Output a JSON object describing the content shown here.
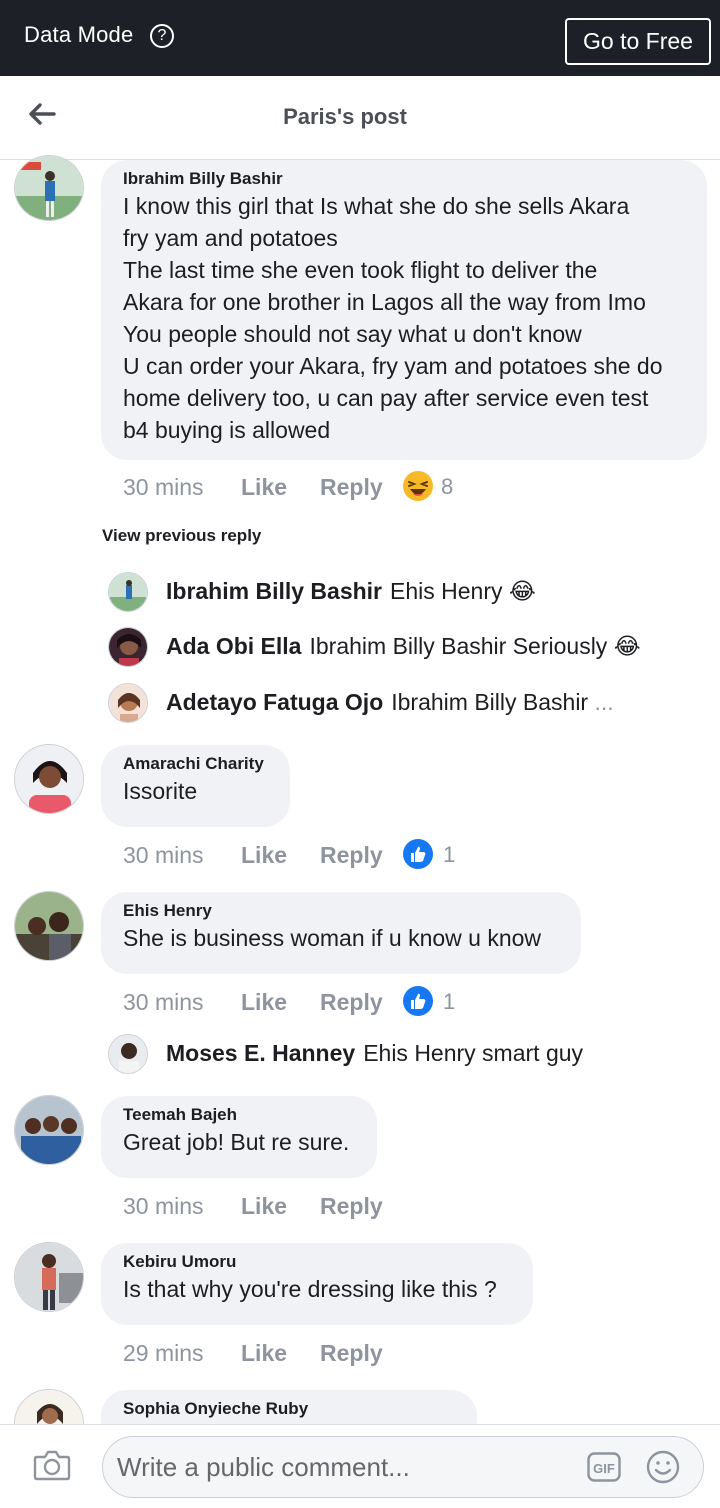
{
  "topbar": {
    "data_mode_label": "Data Mode",
    "help_icon": "question-circle-icon",
    "go_free_label": "Go to Free"
  },
  "header": {
    "back_icon": "arrow-left-icon",
    "title": "Paris's post"
  },
  "comments": [
    {
      "author": "Ibrahim Billy Bashir",
      "text": "I know this girl that Is what she do she sells Akara\nfry yam and potatoes\nThe last time she even took flight to deliver the\nAkara for one brother in Lagos all the way from Imo\nYou people should not say what u don't know\nU can order your Akara, fry yam and potatoes she do\nhome delivery too, u can pay after service even test\nb4 buying is allowed",
      "time": "30 mins",
      "like": "Like",
      "reply": "Reply",
      "reaction_icon": "haha-laughing-icon",
      "reaction_count": "8"
    },
    {
      "author": "Amarachi Charity",
      "text": "Issorite",
      "time": "30 mins",
      "like": "Like",
      "reply": "Reply",
      "reaction_icon": "like-thumbs-up-icon",
      "reaction_count": "1"
    },
    {
      "author": "Ehis Henry",
      "text": "She is business woman if u know u know",
      "time": "30 mins",
      "like": "Like",
      "reply": "Reply",
      "reaction_icon": "like-thumbs-up-icon",
      "reaction_count": "1"
    },
    {
      "author": "Teemah Bajeh",
      "text": "Great job! But re sure.",
      "time": "30 mins",
      "like": "Like",
      "reply": "Reply"
    },
    {
      "author": "Kebiru Umoru",
      "text": "Is that why you're dressing like this ?",
      "time": "29 mins",
      "like": "Like",
      "reply": "Reply"
    },
    {
      "author": "Sophia Onyieche Ruby",
      "text": ""
    }
  ],
  "view_previous_reply": "View previous reply",
  "replies_1": [
    {
      "name": "Ibrahim Billy Bashir",
      "text": "Ehis Henry",
      "emoji": "😂"
    },
    {
      "name": "Ada Obi Ella",
      "text": "Ibrahim Billy Bashir Seriously",
      "emoji": "😂"
    },
    {
      "name": "Adetayo Fatuga Ojo",
      "text": "Ibrahim Billy Bashir",
      "more": " ..."
    }
  ],
  "replies_3": [
    {
      "name": "Moses E. Hanney",
      "text": "Ehis Henry smart guy"
    }
  ],
  "composer": {
    "camera_icon": "camera-icon",
    "placeholder": "Write a public comment...",
    "gif_icon": "gif-icon",
    "emoji_icon": "smiley-icon",
    "gif_label": "GIF"
  },
  "colors": {
    "topbar": "#1d2127",
    "bubble": "#f0f2f5",
    "meta": "#8d949e",
    "like_blue": "#1877f2"
  }
}
